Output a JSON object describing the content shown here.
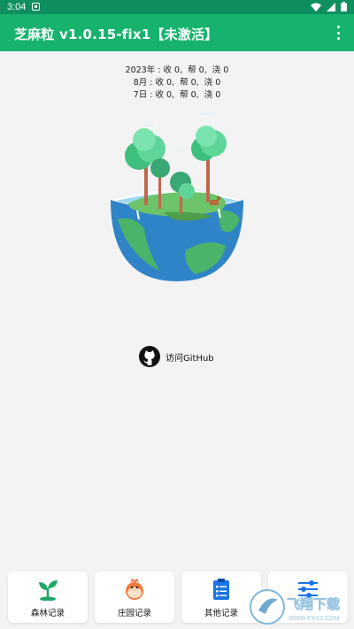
{
  "status_bar": {
    "time": "3:04",
    "icons": [
      "notification-icon",
      "wifi-icon",
      "signal-icon",
      "battery-icon"
    ]
  },
  "app_bar": {
    "title": "芝麻粒 v1.0.15-fix1【未激活】",
    "menu_icon": "more-vert-icon",
    "color": "#17b36e"
  },
  "stats": {
    "year": "2023年 : 收 0,  帮 0,  浇 0",
    "month": "8月 : 收 0,  帮 0,  浇 0",
    "day": "7日 : 收 0,  帮 0,  浇 0"
  },
  "github": {
    "label": "访问GitHub",
    "icon": "github-icon"
  },
  "bottom_nav": {
    "items": [
      {
        "label": "森林记录",
        "icon": "sprout-icon"
      },
      {
        "label": "庄园记录",
        "icon": "chick-icon"
      },
      {
        "label": "其他记录",
        "icon": "clipboard-icon"
      },
      {
        "label": "",
        "icon": "sliders-icon"
      }
    ]
  },
  "watermark": {
    "text": "飞翔下载",
    "url": "WWW.FXXZ.COM"
  }
}
